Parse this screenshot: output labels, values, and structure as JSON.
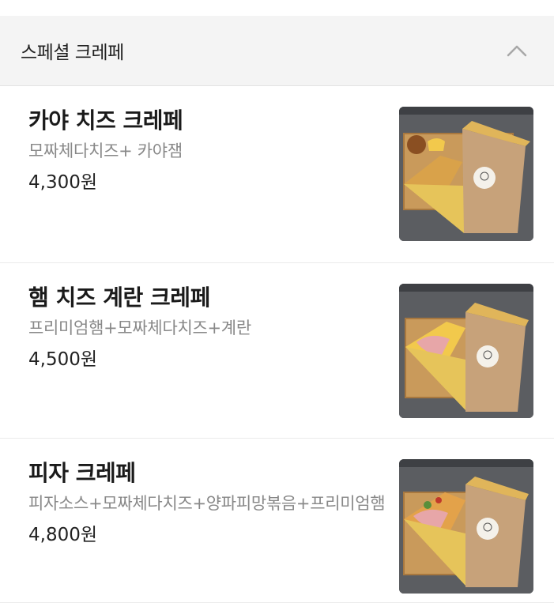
{
  "section": {
    "title": "스페셜 크레페",
    "toggle_icon": "chevron-up-icon"
  },
  "items": [
    {
      "name": "카야 치즈 크레페",
      "description": "모짜체다치즈+ 카야잼",
      "price": "4,300원",
      "image": "kaya-cheese-crepe-photo"
    },
    {
      "name": "햄 치즈 계란 크레페",
      "description": "프리미엄햄+모짜체다치즈+계란",
      "price": "4,500원",
      "image": "ham-cheese-egg-crepe-photo"
    },
    {
      "name": "피자 크레페",
      "description": "피자소스+모짜체다치즈+양파피망볶음+프리미엄햄",
      "price": "4,800원",
      "image": "pizza-crepe-photo"
    }
  ],
  "colors": {
    "header_bg": "#f4f4f4",
    "divider": "#ebebeb",
    "desc_text": "#888888"
  }
}
